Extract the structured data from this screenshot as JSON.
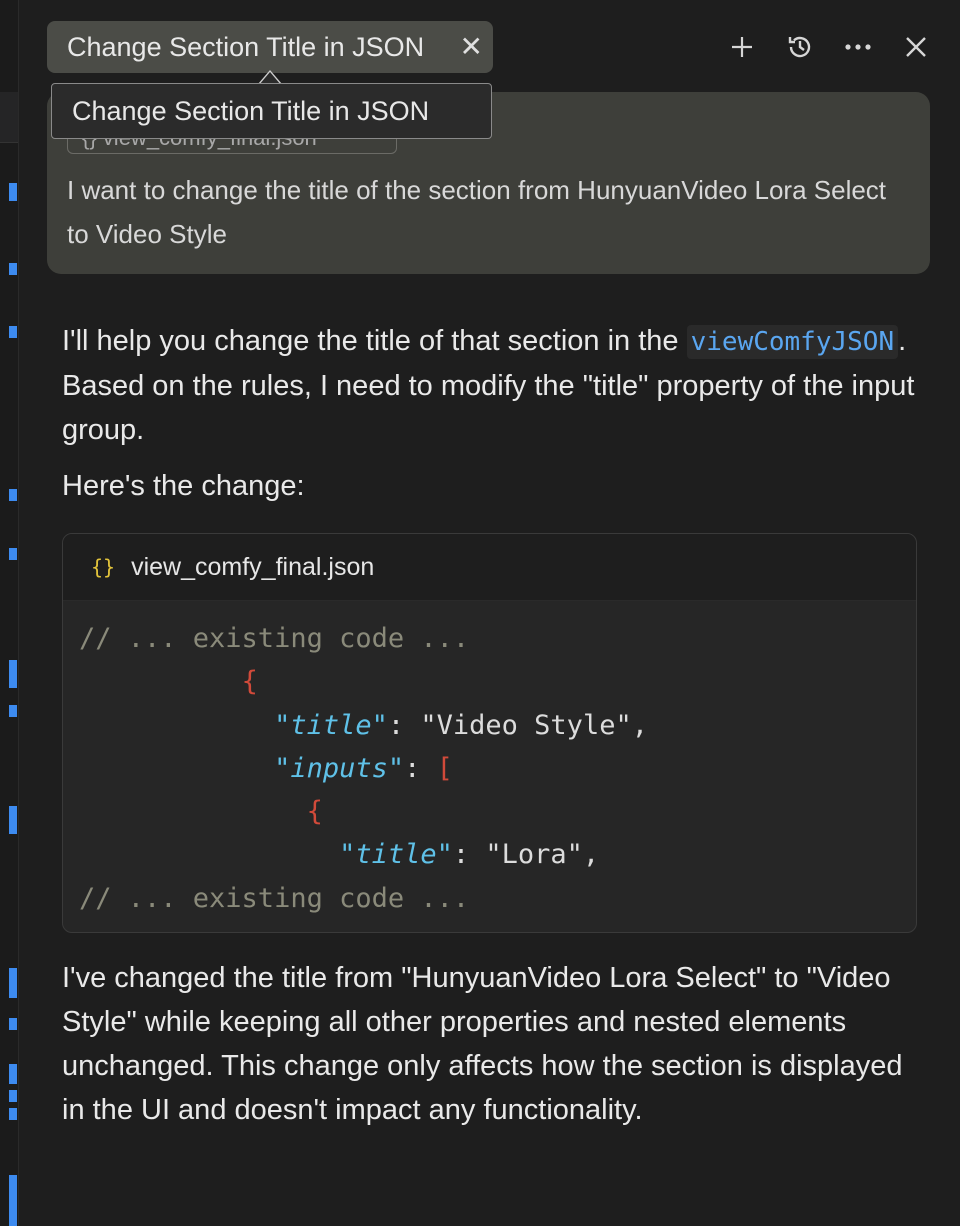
{
  "header": {
    "tab_title": "Change Section Title in JSON",
    "tooltip": "Change Section Title in JSON",
    "icons": [
      "plus-icon",
      "history-icon",
      "more-icon",
      "close-icon"
    ]
  },
  "user_message": {
    "attachment_chip": "{} view_comfy_final.json",
    "text": "I want to change the title of the section from HunyuanVideo Lora Select to Video Style"
  },
  "assistant": {
    "intro_before_code": "I'll help you change the title of that section in the ",
    "inline_code": "viewComfyJSON",
    "intro_after_code": ". Based on the rules, I need to modify the \"title\" property of the input group.",
    "lead": "Here's the change:",
    "code_block": {
      "filename": "view_comfy_final.json",
      "lines": [
        {
          "comment": "// ... existing code ..."
        },
        {
          "indent": "          ",
          "brace": "{"
        },
        {
          "indent": "            ",
          "key": "\"title\"",
          "rest": ": \"Video Style\","
        },
        {
          "indent": "            ",
          "key": "\"inputs\"",
          "rest": ": ",
          "brace": "["
        },
        {
          "indent": "              ",
          "brace": "{"
        },
        {
          "indent": "                ",
          "key": "\"title\"",
          "rest": ": \"Lora\","
        },
        {
          "comment": "// ... existing code ..."
        }
      ]
    },
    "outro": "I've changed the title from \"HunyuanVideo Lora Select\" to \"Video Style\" while keeping all other properties and nested elements unchanged. This change only affects how the section is displayed in the UI and doesn't impact any functionality."
  },
  "colors": {
    "accent_blue": "#3d8bf0",
    "inline_code": "#5aa6f0",
    "json_key": "#5fc1e8",
    "json_brace": "#d14a3a",
    "comment": "#8a8a7a"
  }
}
